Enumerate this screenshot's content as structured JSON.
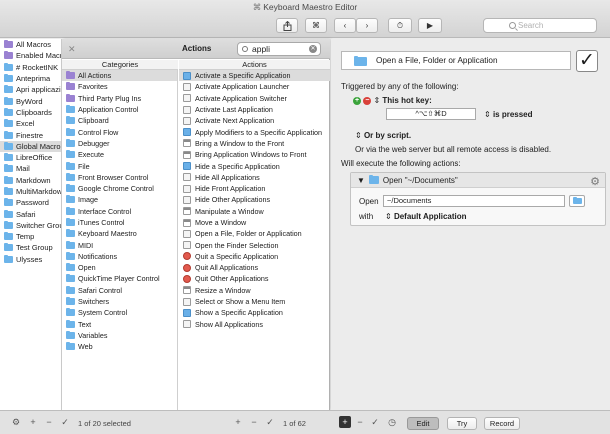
{
  "window": {
    "title": "Keyboard Maestro Editor",
    "title_glyph": "⌘"
  },
  "toolbar": {
    "share_icon": "share-icon",
    "cmd_label": "⌘",
    "back_label": "‹",
    "forward_label": "›",
    "clock_label": "⏱",
    "run_label": "▶",
    "search_placeholder": "Search"
  },
  "macro_list": {
    "items": [
      {
        "label": "All Macros",
        "color": "purple"
      },
      {
        "label": "Enabled Macros",
        "color": "purple"
      },
      {
        "label": "# RocketINK",
        "color": "blue"
      },
      {
        "label": "Anteprima",
        "color": "blue"
      },
      {
        "label": "Apri applicazioni",
        "color": "blue"
      },
      {
        "label": "ByWord",
        "color": "blue"
      },
      {
        "label": "Clipboards",
        "color": "blue"
      },
      {
        "label": "Excel",
        "color": "blue"
      },
      {
        "label": "Finestre",
        "color": "blue"
      },
      {
        "label": "Global Macro Group",
        "color": "blue",
        "selected": true
      },
      {
        "label": "LibreOffice",
        "color": "blue"
      },
      {
        "label": "Mail",
        "color": "blue"
      },
      {
        "label": "Markdown",
        "color": "blue"
      },
      {
        "label": "MultiMarkdown",
        "color": "blue"
      },
      {
        "label": "Password",
        "color": "blue"
      },
      {
        "label": "Safari",
        "color": "blue"
      },
      {
        "label": "Switcher Group",
        "color": "blue"
      },
      {
        "label": "Temp",
        "color": "blue"
      },
      {
        "label": "Test Group",
        "color": "blue"
      },
      {
        "label": "Ulysses",
        "color": "blue"
      }
    ]
  },
  "browser": {
    "title": "Actions",
    "close_label": "✕",
    "search_value": "appli",
    "clear_label": "✕",
    "categories_header": "Categories",
    "actions_header": "Actions",
    "categories": [
      {
        "label": "All Actions",
        "color": "purple",
        "selected": true
      },
      {
        "label": "Favorites",
        "color": "purple"
      },
      {
        "label": "Third Party Plug Ins",
        "color": "purple"
      },
      {
        "label": "Application Control",
        "color": "blue"
      },
      {
        "label": "Clipboard",
        "color": "blue"
      },
      {
        "label": "Control Flow",
        "color": "blue"
      },
      {
        "label": "Debugger",
        "color": "blue"
      },
      {
        "label": "Execute",
        "color": "blue"
      },
      {
        "label": "File",
        "color": "blue"
      },
      {
        "label": "Front Browser Control",
        "color": "blue"
      },
      {
        "label": "Google Chrome Control",
        "color": "blue"
      },
      {
        "label": "Image",
        "color": "blue"
      },
      {
        "label": "Interface Control",
        "color": "blue"
      },
      {
        "label": "iTunes Control",
        "color": "blue"
      },
      {
        "label": "Keyboard Maestro",
        "color": "blue"
      },
      {
        "label": "MIDI",
        "color": "blue"
      },
      {
        "label": "Notifications",
        "color": "blue"
      },
      {
        "label": "Open",
        "color": "blue"
      },
      {
        "label": "QuickTime Player Control",
        "color": "blue"
      },
      {
        "label": "Safari Control",
        "color": "blue"
      },
      {
        "label": "Switchers",
        "color": "blue"
      },
      {
        "label": "System Control",
        "color": "blue"
      },
      {
        "label": "Text",
        "color": "blue"
      },
      {
        "label": "Variables",
        "color": "blue"
      },
      {
        "label": "Web",
        "color": "blue"
      }
    ],
    "actions": [
      {
        "label": "Activate a Specific Application",
        "icon": "blue",
        "selected": true
      },
      {
        "label": "Activate Application Launcher",
        "icon": "plain"
      },
      {
        "label": "Activate Application Switcher",
        "icon": "plain"
      },
      {
        "label": "Activate Last Application",
        "icon": "plain"
      },
      {
        "label": "Activate Next Application",
        "icon": "plain"
      },
      {
        "label": "Apply Modifiers to a Specific Application",
        "icon": "blue"
      },
      {
        "label": "Bring a Window to the Front",
        "icon": "win"
      },
      {
        "label": "Bring Application Windows to Front",
        "icon": "win"
      },
      {
        "label": "Hide a Specific Application",
        "icon": "blue"
      },
      {
        "label": "Hide All Applications",
        "icon": "plain"
      },
      {
        "label": "Hide Front Application",
        "icon": "plain"
      },
      {
        "label": "Hide Other Applications",
        "icon": "plain"
      },
      {
        "label": "Manipulate a Window",
        "icon": "win"
      },
      {
        "label": "Move a Window",
        "icon": "win"
      },
      {
        "label": "Open a File, Folder or Application",
        "icon": "plain"
      },
      {
        "label": "Open the Finder Selection",
        "icon": "plain"
      },
      {
        "label": "Quit a Specific Application",
        "icon": "red"
      },
      {
        "label": "Quit All Applications",
        "icon": "red"
      },
      {
        "label": "Quit Other Applications",
        "icon": "red"
      },
      {
        "label": "Resize a Window",
        "icon": "win"
      },
      {
        "label": "Select or Show a Menu Item",
        "icon": "plain"
      },
      {
        "label": "Show a Specific Application",
        "icon": "blue"
      },
      {
        "label": "Show All Applications",
        "icon": "plain"
      }
    ]
  },
  "editor": {
    "macro_name": "Open a File, Folder or Application",
    "enabled_mark": "✓",
    "triggered_label": "Triggered by any of the following:",
    "add_label": "+",
    "remove_label": "−",
    "hotkey_label": "This hot key:",
    "hotkey_value": "^⌥⇧⌘D",
    "pressed_label": "is pressed",
    "or_script_label": "Or by script.",
    "web_server_text": "Or via the web server but all remote access is disabled.",
    "will_execute_label": "Will execute the following actions:",
    "action_title": "Open \"~/Documents\"",
    "open_label": "Open",
    "path_value": "~/Documents",
    "with_label": "with",
    "with_value": "Default Application",
    "gear_label": "⚙",
    "updown_glyph": "⇕"
  },
  "bottom": {
    "left_count": "1 of 20 selected",
    "mid_count": "1 of 62",
    "edit_label": "Edit",
    "try_label": "Try",
    "record_label": "Record",
    "plus": "+",
    "minus": "−",
    "check": "✓",
    "gear": "⚙"
  }
}
